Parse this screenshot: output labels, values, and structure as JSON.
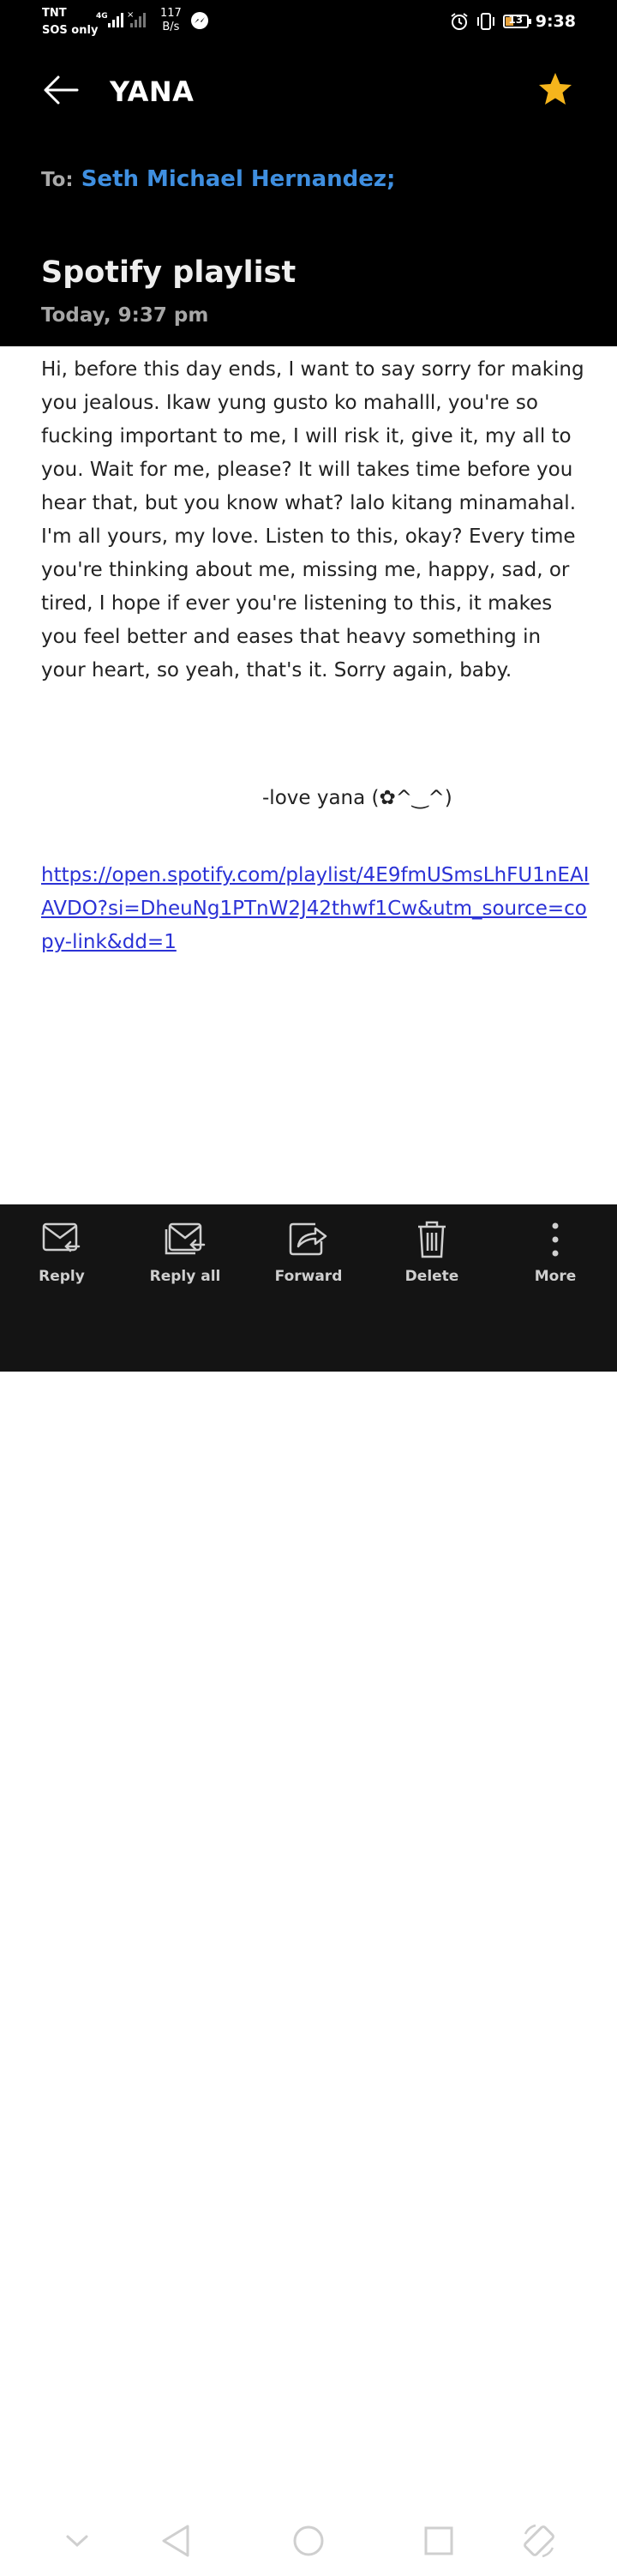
{
  "status_bar": {
    "carrier": "TNT",
    "carrier_sub": "SOS only",
    "network": "4G",
    "speed": "117",
    "speed_unit": "B/s",
    "battery": "13",
    "time": "9:38",
    "icons": [
      "signal-icon",
      "messenger-icon",
      "alarm-icon",
      "vibrate-icon",
      "battery-icon"
    ]
  },
  "header": {
    "title": "YANA",
    "to_label": "To:",
    "recipient": "Seth Michael Hernandez;",
    "subject": "Spotify playlist",
    "date": "Today, 9:37 pm",
    "colors": {
      "background": "#000000",
      "recipient": "#3f8fe0",
      "star": "#f5b51c"
    }
  },
  "body": {
    "message": "Hi, before this day ends, I want to say sorry for making you jealous. Ikaw yung gusto ko mahalll, you're so fucking important to me, I will risk it, give it, my all to you. Wait for me, please? It will takes time before you hear that, but you know what? lalo kitang minamahal. I'm all yours, my love. Listen to this, okay? Every time you're thinking about me, missing me, happy, sad, or tired, I hope if ever you're listening to this, it makes you feel better and eases that heavy something in your heart, so yeah, that's it. Sorry again, baby.",
    "signature": "-love yana (✿^‿^)",
    "link": "https://open.spotify.com/playlist/4E9fmUSmsLhFU1nEAIAVDO?si=DheuNg1PTnW2J42thwf1Cw&utm_source=copy-link&dd=1"
  },
  "actions": [
    {
      "label": "Reply",
      "icon": "reply-icon"
    },
    {
      "label": "Reply all",
      "icon": "reply-all-icon"
    },
    {
      "label": "Forward",
      "icon": "forward-icon"
    },
    {
      "label": "Delete",
      "icon": "trash-icon"
    },
    {
      "label": "More",
      "icon": "more-icon"
    }
  ],
  "nav_bar": [
    "chevron-down-icon",
    "back-triangle-icon",
    "home-circle-icon",
    "recents-square-icon",
    "rotate-icon"
  ]
}
